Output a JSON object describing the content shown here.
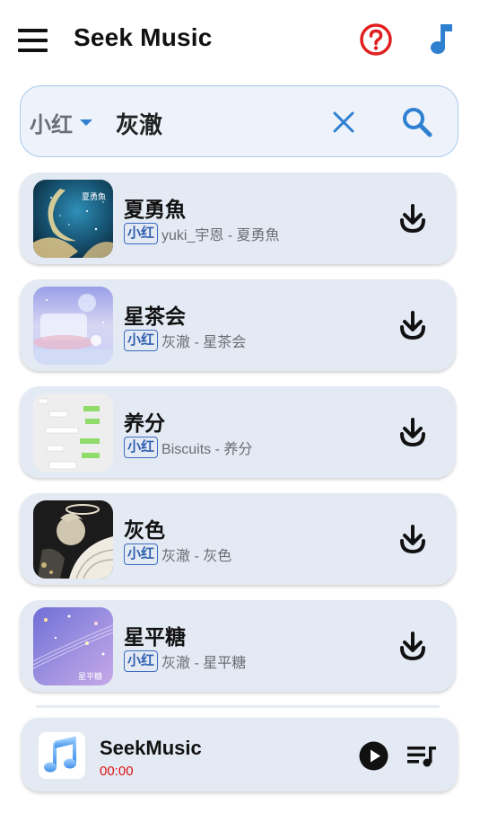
{
  "app": {
    "title": "Seek Music"
  },
  "search": {
    "source": "小红",
    "query": "灰澈"
  },
  "songs": [
    {
      "title": "夏勇魚",
      "source": "小红",
      "artist_album": "yuki_宇恩 - 夏勇魚",
      "cover_text": "夏勇魚",
      "download_icon": "download-icon"
    },
    {
      "title": "星茶会",
      "source": "小红",
      "artist_album": "灰澈 - 星茶会",
      "download_icon": "download-icon"
    },
    {
      "title": "养分",
      "source": "小红",
      "artist_album": "Biscuits - 养分",
      "download_icon": "download-icon"
    },
    {
      "title": "灰色",
      "source": "小红",
      "artist_album": "灰澈 - 灰色",
      "download_icon": "download-icon"
    },
    {
      "title": "星平糖",
      "source": "小红",
      "artist_album": "灰澈 - 星平糖",
      "cover_text": "星平糖",
      "download_icon": "download-icon"
    }
  ],
  "player": {
    "title": "SeekMusic",
    "time": "00:00",
    "play_icon": "play-icon",
    "queue_icon": "queue-icon"
  },
  "colors": {
    "accent": "#2f80d1",
    "help": "#e02020",
    "time": "#dd1111",
    "card": "#e4eaf4"
  }
}
